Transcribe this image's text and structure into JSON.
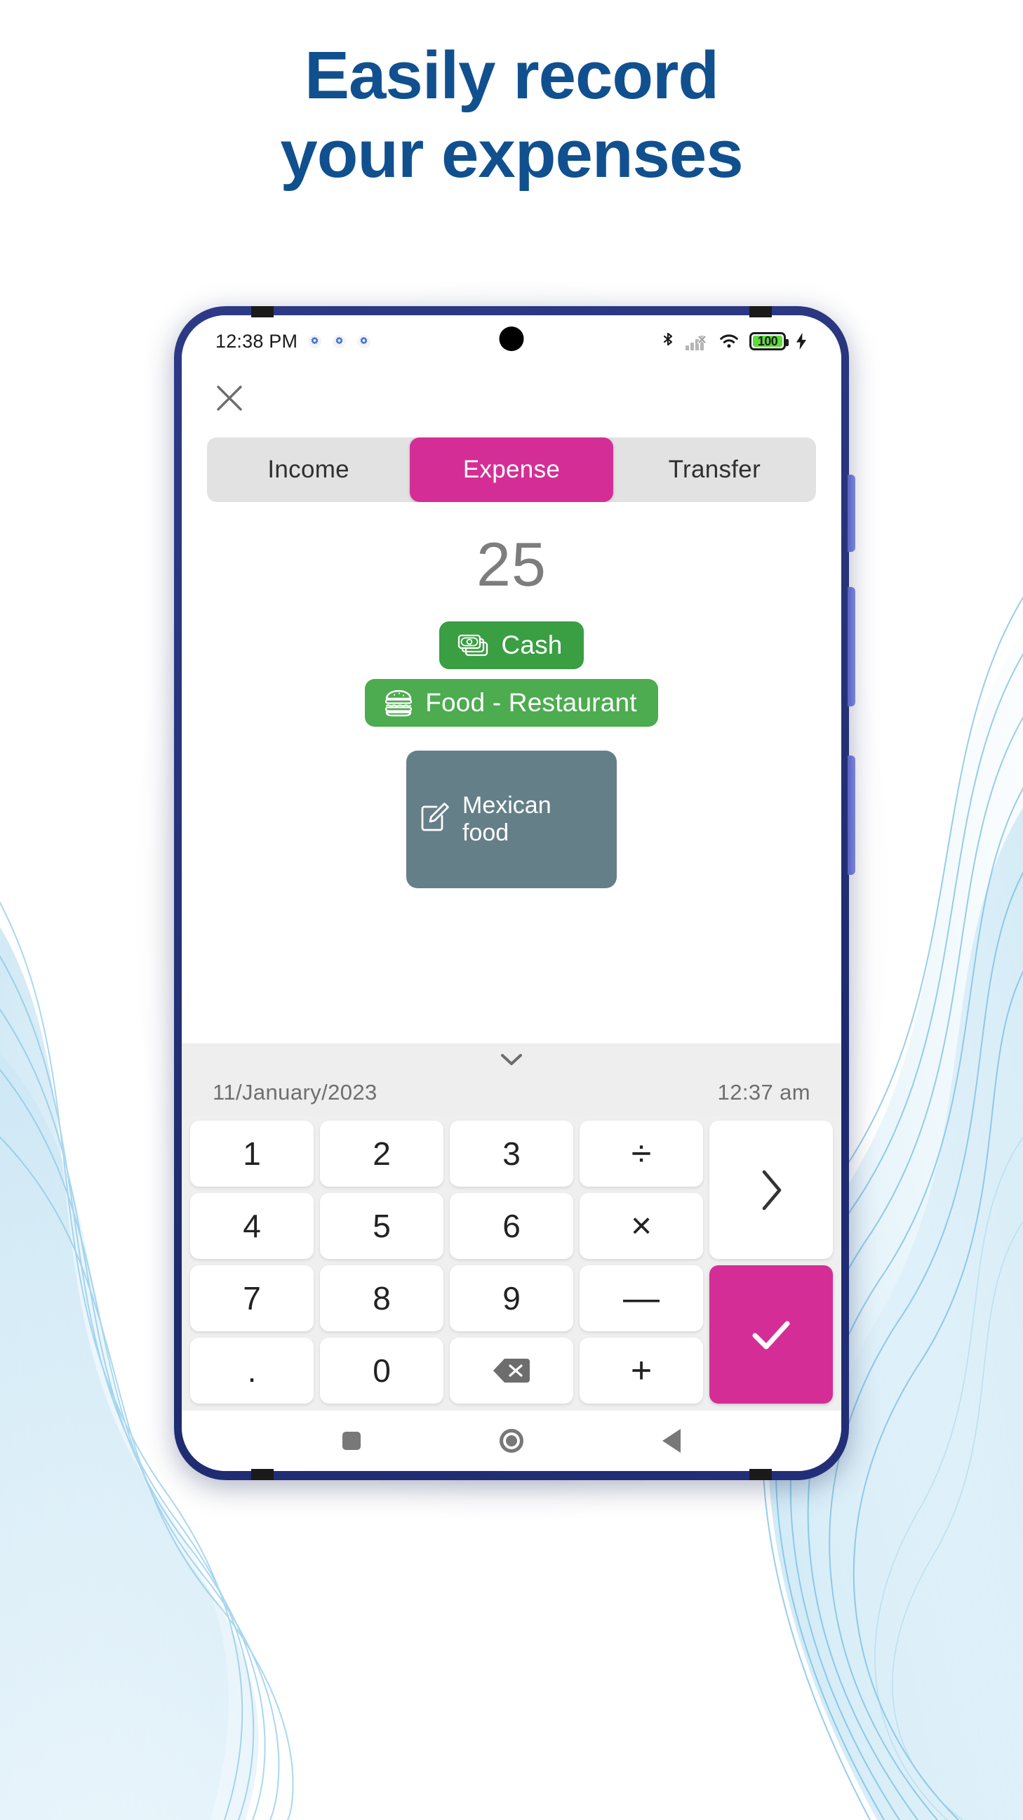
{
  "promo": {
    "headline_line1": "Easily record",
    "headline_line2": "your expenses",
    "headline_color": "#10508f",
    "background_color": "#ffffff"
  },
  "phone": {
    "frame_color": "#27347c",
    "status_bar": {
      "time": "12:38 PM",
      "notification_icons": [
        "gear-icon",
        "gear-icon",
        "gear-icon"
      ],
      "bluetooth_icon": "bluetooth-icon",
      "signal_icon": "signal-no-service-icon",
      "wifi_icon": "wifi-icon",
      "battery_level": "100",
      "battery_color": "#5ddb3a",
      "charging_icon": "charging-bolt-icon"
    },
    "nav_bar": {
      "recents_label": "recents-square-icon",
      "home_label": "home-circle-icon",
      "back_label": "back-triangle-icon"
    }
  },
  "app": {
    "close_button_label": "close-icon",
    "accent_color": "#d42e96",
    "tabs": [
      {
        "label": "Income",
        "active": false
      },
      {
        "label": "Expense",
        "active": true
      },
      {
        "label": "Transfer",
        "active": false
      }
    ],
    "amount": "25",
    "chips": [
      {
        "label": "Cash",
        "icon": "banknotes-icon",
        "color": "#3a9e42"
      },
      {
        "label": "Food - Restaurant",
        "icon": "burger-icon",
        "color": "#4cac4f"
      }
    ],
    "note": {
      "label": "Mexican food",
      "icon": "edit-note-icon",
      "color": "#657f89"
    },
    "collapse_icon": "chevron-down-icon",
    "date": "11/January/2023",
    "time": "12:37 am",
    "keypad": {
      "keys": [
        {
          "label": "1",
          "type": "digit"
        },
        {
          "label": "2",
          "type": "digit"
        },
        {
          "label": "3",
          "type": "digit"
        },
        {
          "label": "÷",
          "type": "operator"
        },
        {
          "label": "4",
          "type": "digit"
        },
        {
          "label": "5",
          "type": "digit"
        },
        {
          "label": "6",
          "type": "digit"
        },
        {
          "label": "×",
          "type": "operator"
        },
        {
          "label": "7",
          "type": "digit"
        },
        {
          "label": "8",
          "type": "digit"
        },
        {
          "label": "9",
          "type": "digit"
        },
        {
          "label": "—",
          "type": "operator"
        },
        {
          "label": ".",
          "type": "digit"
        },
        {
          "label": "0",
          "type": "digit"
        },
        {
          "label": "backspace-icon",
          "type": "backspace"
        },
        {
          "label": "+",
          "type": "operator"
        }
      ],
      "next_label": "chevron-right-icon",
      "submit_label": "checkmark-icon"
    }
  }
}
